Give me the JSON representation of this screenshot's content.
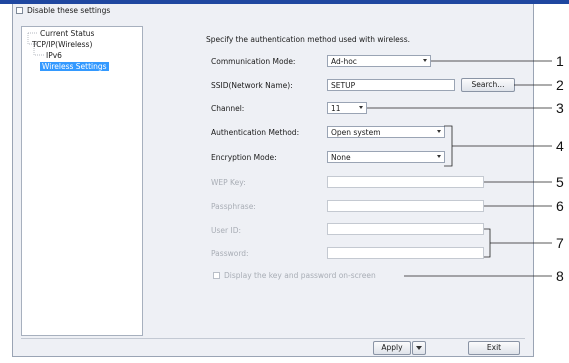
{
  "top": {
    "disable_label": "Disable these settings"
  },
  "tree": {
    "items": [
      "Current Status",
      "TCP/IP(Wireless)",
      "IPv6",
      "Wireless Settings"
    ]
  },
  "panel": {
    "intro": "Specify the authentication method used with wireless.",
    "communication_mode": {
      "label": "Communication Mode:",
      "value": "Ad-hoc"
    },
    "ssid": {
      "label": "SSID(Network Name):",
      "value": "SETUP",
      "search_button": "Search..."
    },
    "channel": {
      "label": "Channel:",
      "value": "11"
    },
    "auth_method": {
      "label": "Authentication Method:",
      "value": "Open system"
    },
    "encryption_mode": {
      "label": "Encryption Mode:",
      "value": "None"
    },
    "wep_key": {
      "label": "WEP Key:",
      "value": ""
    },
    "passphrase": {
      "label": "Passphrase:",
      "value": ""
    },
    "user_id": {
      "label": "User ID:",
      "value": ""
    },
    "password": {
      "label": "Password:",
      "value": ""
    },
    "display_key_label": "Display the key and password on-screen"
  },
  "footer": {
    "apply_label": "Apply",
    "exit_label": "Exit"
  },
  "callouts": [
    "1",
    "2",
    "3",
    "4",
    "5",
    "6",
    "7",
    "8"
  ],
  "colors": {
    "accent": "#1f47a0",
    "selection": "#3399ff"
  }
}
